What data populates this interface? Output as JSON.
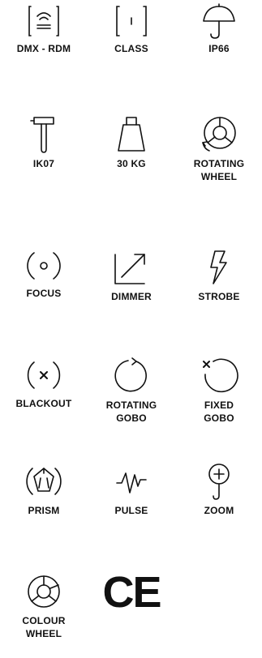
{
  "features": [
    {
      "icon": "dmx-rdm-icon",
      "label": "DMX - RDM"
    },
    {
      "icon": "class-icon",
      "label": "CLASS"
    },
    {
      "icon": "umbrella-icon",
      "label": "IP66"
    },
    {
      "icon": "hammer-icon",
      "label": "IK07"
    },
    {
      "icon": "weight-icon",
      "label": "30 KG"
    },
    {
      "icon": "rotating-wheel-icon",
      "label": "ROTATING\nWHEEL"
    },
    {
      "icon": "focus-icon",
      "label": "FOCUS"
    },
    {
      "icon": "dimmer-icon",
      "label": "DIMMER"
    },
    {
      "icon": "strobe-icon",
      "label": "STROBE"
    },
    {
      "icon": "blackout-icon",
      "label": "BLACKOUT"
    },
    {
      "icon": "rotating-gobo-icon",
      "label": "ROTATING\nGOBO"
    },
    {
      "icon": "fixed-gobo-icon",
      "label": "FIXED\nGOBO"
    },
    {
      "icon": "prism-icon",
      "label": "PRISM"
    },
    {
      "icon": "pulse-icon",
      "label": "PULSE"
    },
    {
      "icon": "zoom-icon",
      "label": "ZOOM"
    },
    {
      "icon": "colour-wheel-icon",
      "label": "COLOUR\nWHEEL"
    },
    {
      "icon": "ce-mark-icon",
      "label": "CE"
    }
  ],
  "colors": {
    "ink": "#111111",
    "background": "#ffffff"
  }
}
